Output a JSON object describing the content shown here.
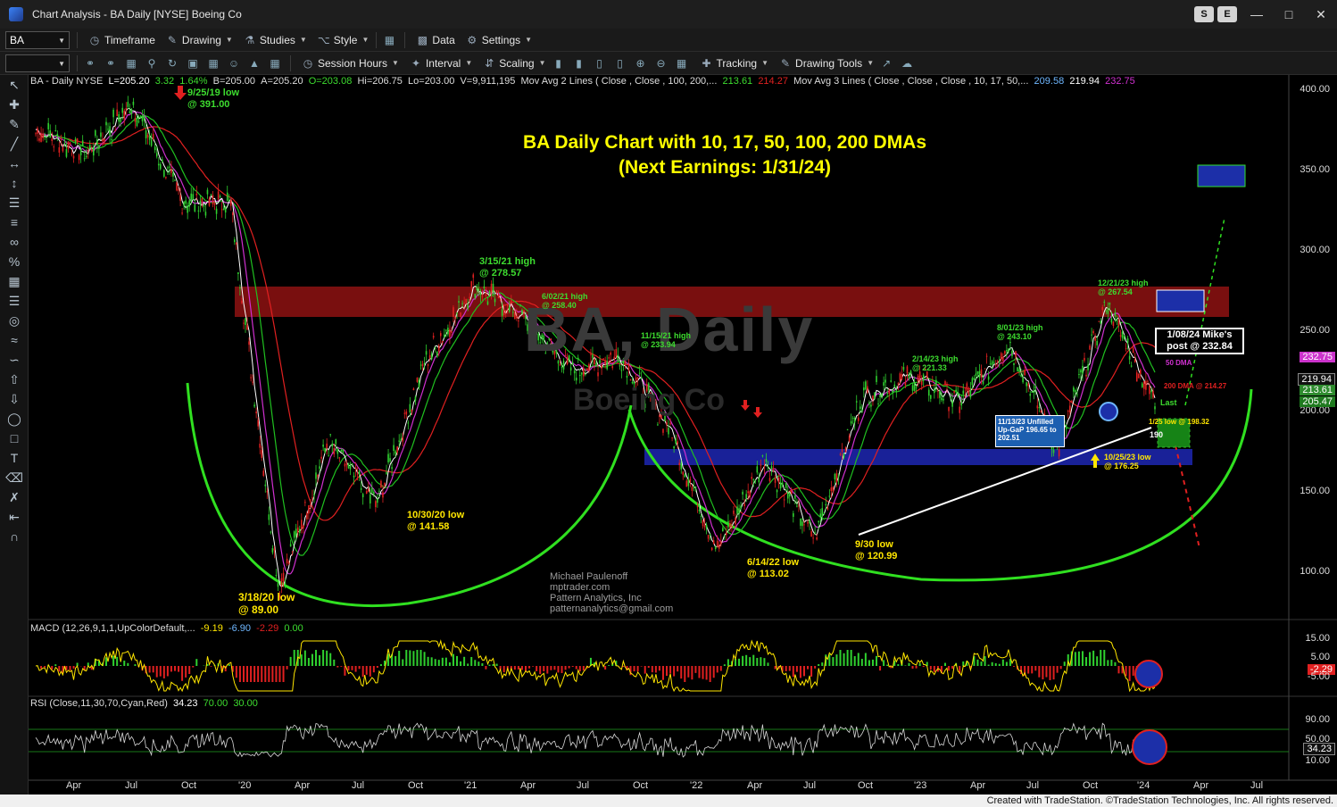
{
  "window": {
    "title": "Chart Analysis - BA Daily [NYSE] Boeing Co",
    "buttons": [
      "S",
      "E"
    ]
  },
  "toolbar1": {
    "symbol": "BA",
    "timeframe": "Timeframe",
    "drawing": "Drawing",
    "studies": "Studies",
    "style": "Style",
    "data": "Data",
    "settings": "Settings"
  },
  "toolbar2": {
    "session_hours": "Session Hours",
    "interval": "Interval",
    "scaling": "Scaling",
    "tracking": "Tracking",
    "drawing_tools": "Drawing Tools"
  },
  "chart_header": {
    "symbol_line": "BA - Daily  NYSE",
    "last": "L=205.20",
    "change": "3.32",
    "pct": "1.64%",
    "bid": "B=205.00",
    "ask": "A=205.20",
    "open": "O=203.08",
    "high": "Hi=206.75",
    "low": "Lo=203.00",
    "volume": "V=9,911,195",
    "mav2": "Mov Avg 2 Lines (      Close ,      Close ,  100,  200,...",
    "mav2_v1": "213.61",
    "mav2_v2": "214.27",
    "mav3": "Mov Avg 3 Lines ( Close , Close , Close , 10, 17, 50,...",
    "mav3_v1": "209.58",
    "mav3_v2": "219.94",
    "mav3_v3": "232.75"
  },
  "chart_title": {
    "line1": "BA Daily Chart with 10, 17, 50, 100, 200 DMAs",
    "line2": "(Next Earnings: 1/31/24)"
  },
  "watermark": {
    "line1": "BA, Daily",
    "line2": "Boeing Co"
  },
  "annotations": {
    "a1": "9/25/19 low",
    "a1b": "@ 391.00",
    "a2": "3/15/21 high",
    "a2b": "@ 278.57",
    "a3": "6/02/21 high",
    "a3b": "@ 258.40",
    "a4": "11/15/21 high",
    "a4b": "@ 233.94",
    "a5": "8/01/23 high",
    "a5b": "@ 243.10",
    "a6": "12/21/23 high",
    "a6b": "@ 267.54",
    "a7": "2/14/23 high",
    "a7b": "@ 221.33",
    "a8": "10/30/20 low",
    "a8b": "@ 141.58",
    "a9": "3/18/20 low",
    "a9b": "@ 89.00",
    "a10": "6/14/22 low",
    "a10b": "@ 113.02",
    "a11": "9/30  low",
    "a11b": "@ 120.99",
    "a12": "10/25/23 low",
    "a12b": "@ 176.25",
    "a13": "1/25 low @ 198.32",
    "a14": "190",
    "a15": "50 DMA",
    "a16": "200 DMA @ 214.27",
    "a17": "Last",
    "gap1": "11/13/23 Unfilled",
    "gap2": "Up-GaP 196.65 to",
    "gap3": "202.51",
    "post1": "1/08/24 Mike's",
    "post2": "post @ 232.84"
  },
  "credit": {
    "l1": "Michael Paulenoff",
    "l2": "mptrader.com",
    "l3": "Pattern Analytics, Inc",
    "l4": "patternanalytics@gmail.com"
  },
  "price_axis": {
    "labels": [
      "400.00",
      "350.00",
      "300.00",
      "250.00",
      "200.00",
      "150.00",
      "100.00"
    ],
    "tags": [
      {
        "text": "232.75",
        "color": "#cc33cc"
      },
      {
        "text": "219.94",
        "color": "#111111"
      },
      {
        "text": "213.61",
        "color": "#2e8b2e"
      },
      {
        "text": "205.47",
        "color": "#1f7a1f"
      }
    ]
  },
  "macd": {
    "header": "MACD (12,26,9,1,1,UpColorDefault,...",
    "v1": "-9.19",
    "v2": "-6.90",
    "v3": "-2.29",
    "v4": "0.00",
    "labels": [
      "15.00",
      "5.00",
      "-2.29",
      "-5.00"
    ]
  },
  "rsi": {
    "header": "RSI (Close,11,30,70,Cyan,Red)",
    "v1": "34.23",
    "v2": "70.00",
    "v3": "30.00",
    "labels": [
      "90.00",
      "50.00",
      "34.23",
      "10.00"
    ]
  },
  "time_axis": [
    "Apr",
    "Jul",
    "Oct",
    "'20",
    "Apr",
    "Jul",
    "Oct",
    "'21",
    "Apr",
    "Jul",
    "Oct",
    "'22",
    "Apr",
    "Jul",
    "Oct",
    "'23",
    "Apr",
    "Jul",
    "Oct",
    "'24",
    "Apr",
    "Jul"
  ],
  "footer": "Created with TradeStation. ©TradeStation Technologies, Inc. All rights reserved.",
  "chart_data": {
    "type": "line",
    "title": "BA Daily Chart with 10, 17, 50, 100, 200 DMAs",
    "ylim": [
      80,
      410
    ],
    "x": [
      "2019-04",
      "2019-07",
      "2019-09",
      "2020-01",
      "2020-02",
      "2020-03",
      "2020-06",
      "2020-10",
      "2021-01",
      "2021-03",
      "2021-06",
      "2021-09",
      "2021-11",
      "2022-03",
      "2022-06",
      "2022-08",
      "2022-09",
      "2023-01",
      "2023-02",
      "2023-05",
      "2023-08",
      "2023-10",
      "2023-12",
      "2024-01"
    ],
    "series": [
      {
        "name": "BA",
        "values": [
          375,
          360,
          391,
          330,
          330,
          89,
          180,
          142,
          230,
          278,
          258,
          225,
          234,
          190,
          113,
          170,
          121,
          210,
          221,
          205,
          243,
          176,
          267,
          205
        ]
      }
    ]
  }
}
